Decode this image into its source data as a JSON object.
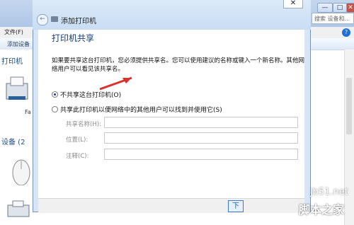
{
  "window_title_controls": {
    "minimize": "—",
    "maximize": "□",
    "close": "✕"
  },
  "background": {
    "menu": "文件(F)",
    "toolbar": "添加设备",
    "section_printers": "打印机",
    "section_devices": "设备 (2",
    "device_label": "Fa",
    "search_placeholder": "搜索 设备和...",
    "help": "?"
  },
  "dialog": {
    "title": "添加打印机",
    "close": "✕",
    "heading": "打印机共享",
    "description": "如果要共享这台打印机，您必须提供共享名。您可以使用建议的名称或键入一个新名称。其他网络用户可以看见该共享名。",
    "option_no_share": "不共享这台打印机(O)",
    "option_share": "共享此打印机以便网络中的其他用户可以找到并使用它(S)",
    "labels": {
      "share_name": "共享名称(H):",
      "location": "位置(L):",
      "comment": "注释(C):"
    },
    "next_button": "下"
  },
  "watermark": {
    "url": "jb51.net",
    "text": "脚本之家"
  },
  "colors": {
    "accent": "#113c78",
    "dialog_frame": "#d7e5f6",
    "arrow": "#d9322c"
  }
}
